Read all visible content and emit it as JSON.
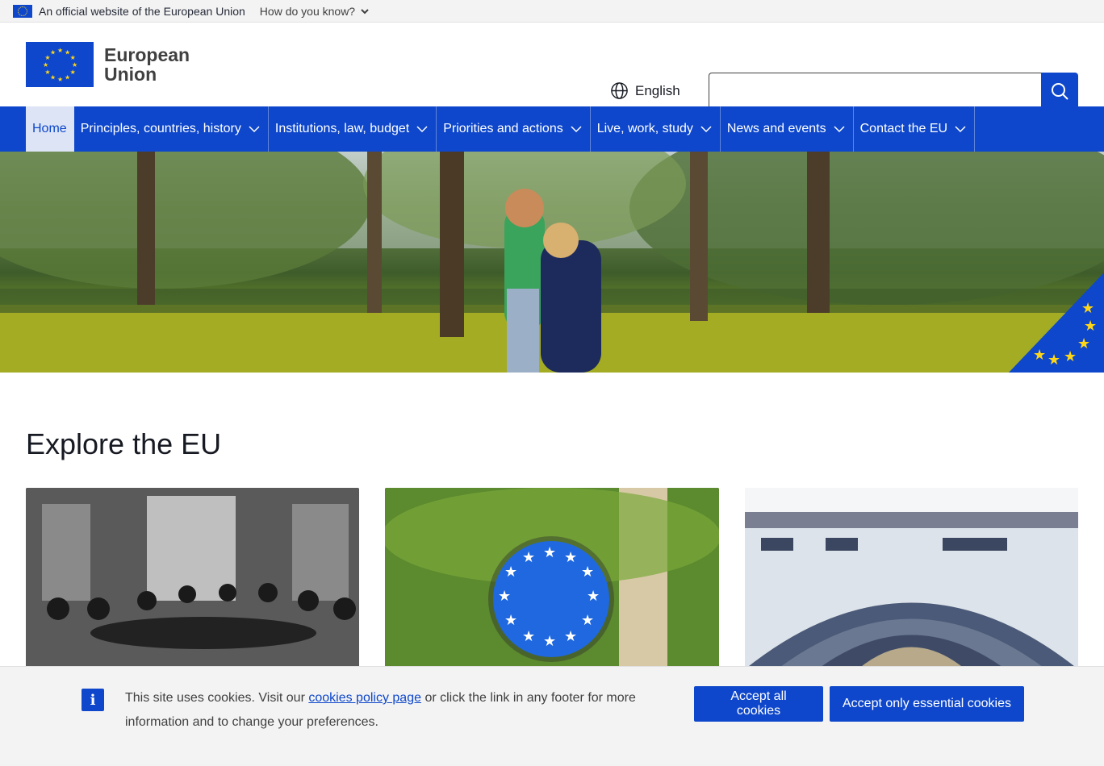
{
  "official_bar": {
    "text": "An official website of the European Union",
    "how_label": "How do you know?"
  },
  "header": {
    "logo_line1": "European",
    "logo_line2": "Union",
    "language": "English",
    "search_placeholder": ""
  },
  "nav": {
    "items": [
      {
        "label": "Home",
        "active": true
      },
      {
        "label": "Principles, countries, history"
      },
      {
        "label": "Institutions, law, budget"
      },
      {
        "label": "Priorities and actions"
      },
      {
        "label": "Live, work, study"
      },
      {
        "label": "News and events"
      },
      {
        "label": "Contact the EU"
      }
    ]
  },
  "explore": {
    "title": "Explore the EU"
  },
  "cookie": {
    "text_before": "This site uses cookies. Visit our ",
    "link_text": "cookies policy page",
    "text_after": " or click the link in any footer for more information and to change your preferences.",
    "accept_all": "Accept all cookies",
    "accept_essential": "Accept only essential cookies"
  },
  "colors": {
    "brand_blue": "#0e47cb",
    "star_yellow": "#ffd617"
  }
}
